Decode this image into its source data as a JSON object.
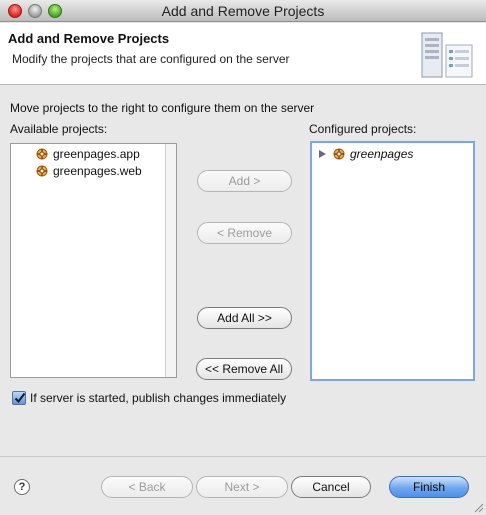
{
  "window": {
    "title": "Add and Remove Projects"
  },
  "banner": {
    "title": "Add and Remove Projects",
    "description": "Modify the projects that are configured on the server",
    "icon": "server-icon"
  },
  "instructions": "Move projects to the right to configure them on the server",
  "available": {
    "label": "Available projects:",
    "items": [
      "greenpages.app",
      "greenpages.web"
    ]
  },
  "configured": {
    "label": "Configured projects:",
    "items": [
      "greenpages"
    ]
  },
  "buttons": {
    "add": "Add >",
    "remove": "< Remove",
    "add_all": "Add All >>",
    "remove_all": "<< Remove All",
    "back": "< Back",
    "next": "Next >",
    "cancel": "Cancel",
    "finish": "Finish"
  },
  "publish_checkbox": {
    "label": "If server is started, publish changes immediately",
    "checked": true
  },
  "help": {
    "glyph": "?"
  },
  "colors": {
    "default_button": "#4f8fe6",
    "focus_ring": "#7da6de",
    "close": "#d7261f",
    "zoom": "#4aa22a"
  }
}
